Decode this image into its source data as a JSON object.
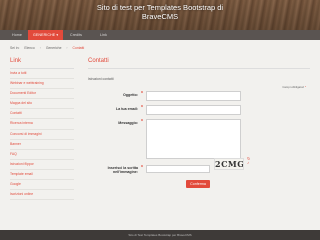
{
  "header": {
    "title_line1": "Sito di test per Templates Bootstrap di",
    "title_line2": "BraveCMS"
  },
  "nav": {
    "items": [
      "Home",
      "GENERICHE",
      "Credits",
      "Link"
    ],
    "active_index": 1,
    "dropdown_icon": "chevron-down-icon"
  },
  "breadcrumb": {
    "items": [
      "Sei in:",
      "Elenco",
      "Generiche",
      "Contatti"
    ],
    "separator": "›"
  },
  "sidebar": {
    "title": "Link",
    "items": [
      "Invia a tutti",
      "Webinar e webtraining",
      "Documenti Editor",
      "Mappa del sito",
      "Contatti",
      "Ricerca interna",
      "Concorsi di immagini",
      "Banner",
      "FAQ",
      "Istruzioni flippor",
      "Template email",
      "Google",
      "Iscrizioni online"
    ]
  },
  "main": {
    "title": "Contatti",
    "intro": "Istruzioni contatti",
    "required_note": "Campi obbligatori",
    "form": {
      "subject_label": "Oggetto:",
      "email_label": "La tua email:",
      "message_label": "Messaggio:",
      "captcha_label_line1": "Inserisci la scritta",
      "captcha_label_line2": "nell'immagine:",
      "captcha_image_text": "2CMG",
      "required_marker": "*",
      "submit_label": "Conferma"
    }
  },
  "footer": {
    "text": "Sito di Test Templates Bootstrap per BraveCMS"
  },
  "colors": {
    "accent": "#e24a3b",
    "nav_background": "#5a5451",
    "footer_background": "#3e3a38"
  }
}
